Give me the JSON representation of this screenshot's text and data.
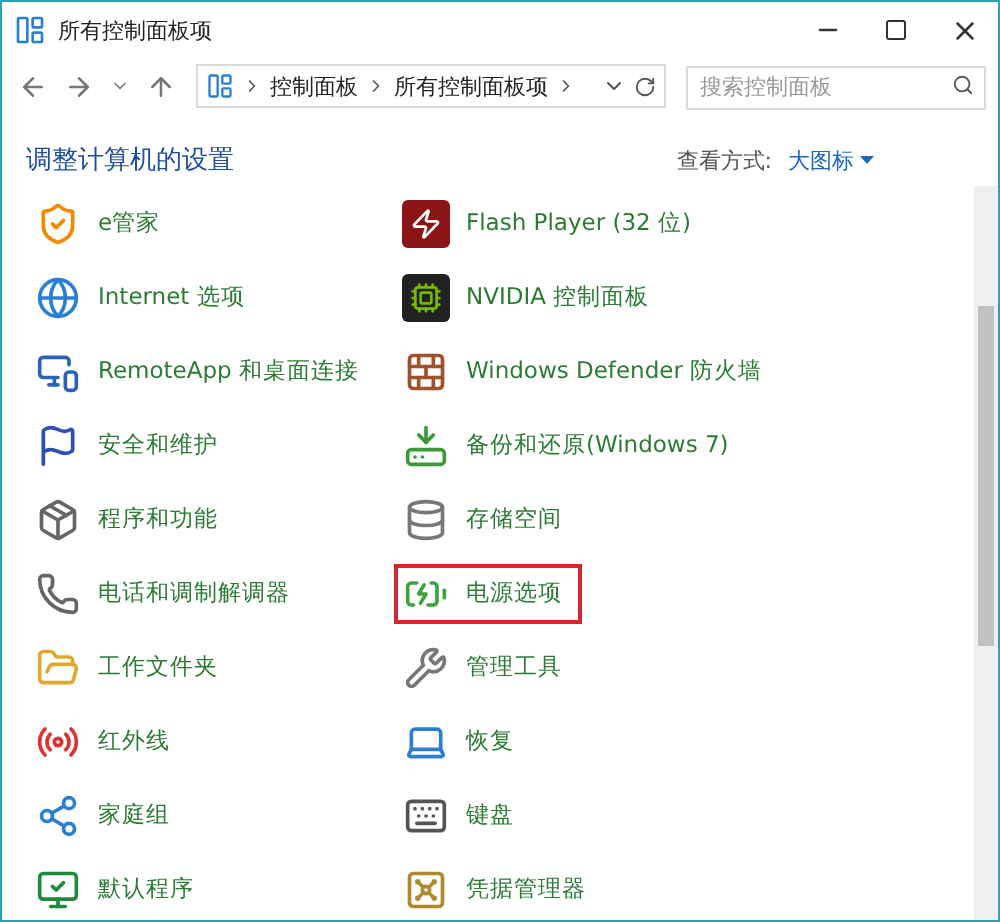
{
  "window": {
    "title": "所有控制面板项"
  },
  "address_bar": {
    "breadcrumbs": [
      "控制面板",
      "所有控制面板项"
    ]
  },
  "search": {
    "placeholder": "搜索控制面板"
  },
  "heading": "调整计算机的设置",
  "view_by": {
    "label": "查看方式:",
    "value": "大图标"
  },
  "items": [
    {
      "label": "e管家",
      "selected": false
    },
    {
      "label": "Flash Player (32 位)",
      "selected": false
    },
    {
      "label": "Internet 选项",
      "selected": false
    },
    {
      "label": "NVIDIA 控制面板",
      "selected": false
    },
    {
      "label": "RemoteApp 和桌面连接",
      "selected": false
    },
    {
      "label": "Windows Defender 防火墙",
      "selected": false
    },
    {
      "label": "安全和维护",
      "selected": false
    },
    {
      "label": "备份和还原(Windows 7)",
      "selected": false
    },
    {
      "label": "程序和功能",
      "selected": false
    },
    {
      "label": "存储空间",
      "selected": false
    },
    {
      "label": "电话和调制解调器",
      "selected": false
    },
    {
      "label": "电源选项",
      "selected": true
    },
    {
      "label": "工作文件夹",
      "selected": false
    },
    {
      "label": "管理工具",
      "selected": false
    },
    {
      "label": "红外线",
      "selected": false
    },
    {
      "label": "恢复",
      "selected": false
    },
    {
      "label": "家庭组",
      "selected": false
    },
    {
      "label": "键盘",
      "selected": false
    },
    {
      "label": "默认程序",
      "selected": false
    },
    {
      "label": "凭据管理器",
      "selected": false
    }
  ]
}
